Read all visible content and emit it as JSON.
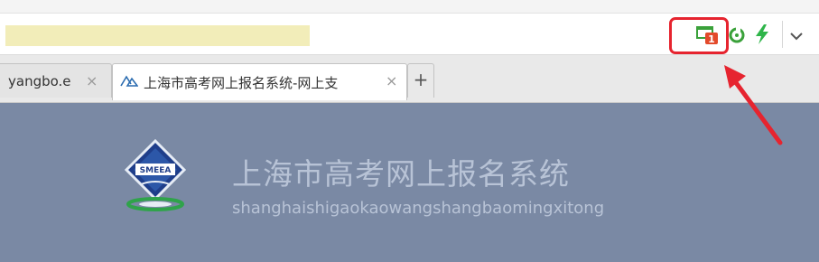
{
  "browser": {
    "toolbar_icons": [
      "tab-notification-icon",
      "refresh-plugin-icon",
      "lightning-icon",
      "chevron-down-icon"
    ],
    "notification_badge": "1",
    "tabs": [
      {
        "label": "yangbo.e",
        "active": false
      },
      {
        "label": "上海市高考网上报名系统-网上支",
        "active": true
      }
    ],
    "new_tab_label": "+",
    "close_label": "×"
  },
  "page": {
    "title": "上海市高考网上报名系统",
    "subtitle": "shanghaishigaokaowangshangbaomingxitong",
    "logo_text": "SMEEA"
  },
  "colors": {
    "content_bg": "#7a89a4",
    "highlight_box": "#e6242f",
    "url_highlight": "#f2edb9"
  }
}
